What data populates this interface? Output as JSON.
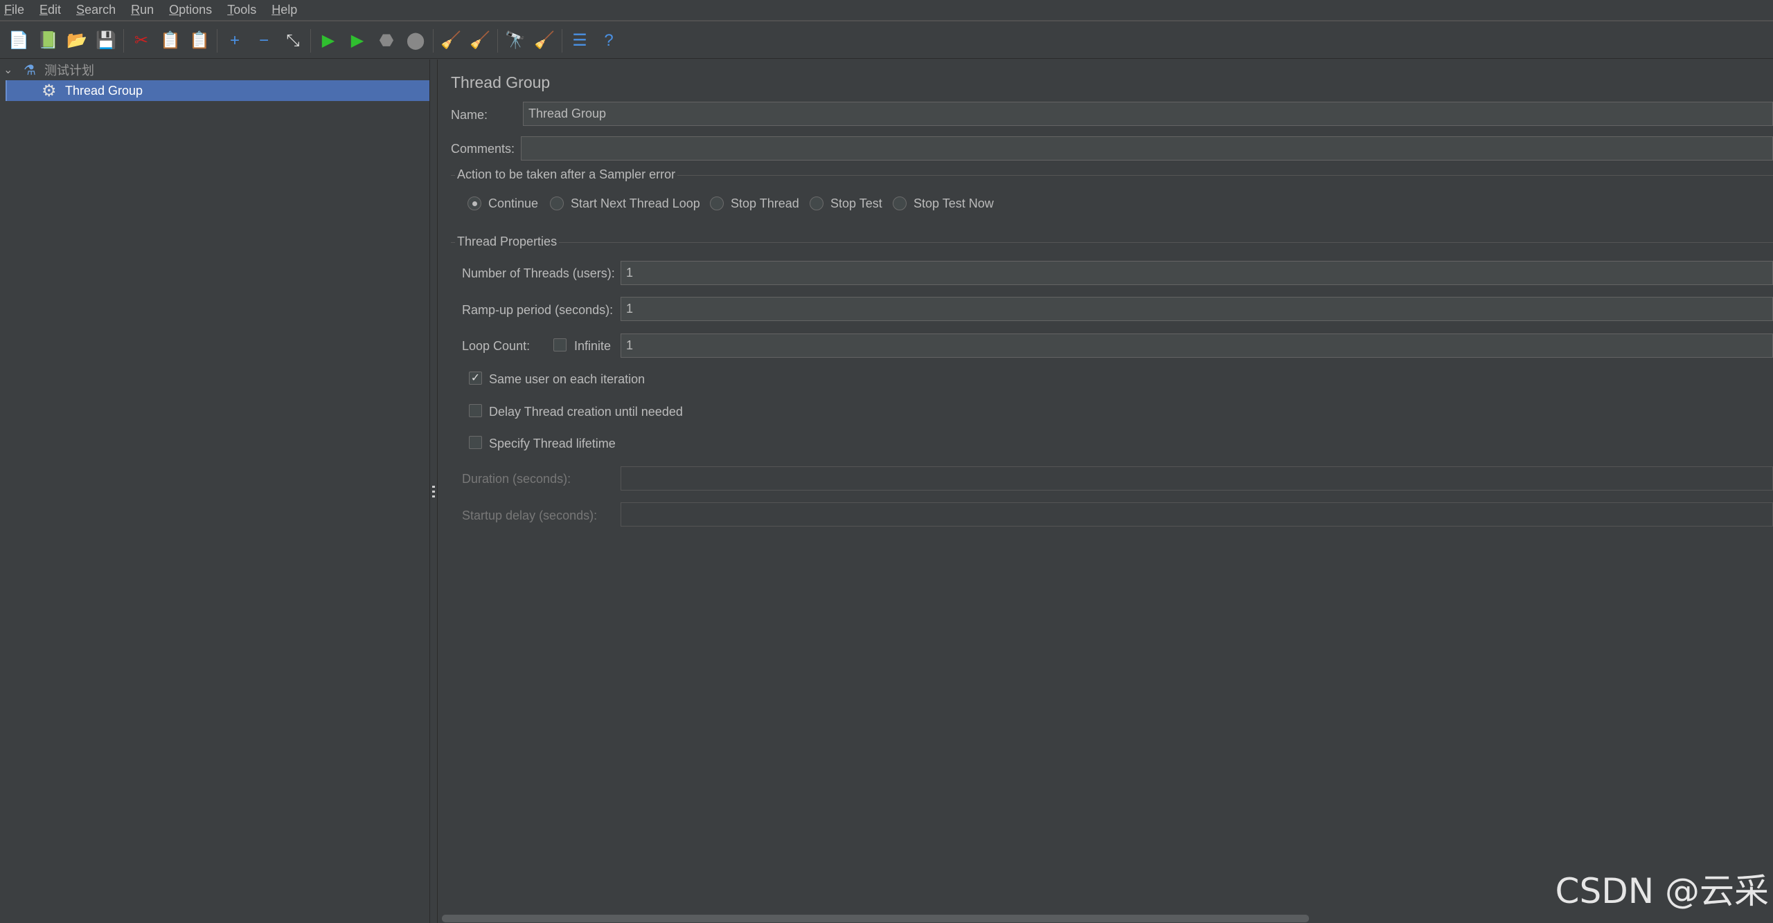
{
  "menu": [
    "File",
    "Edit",
    "Search",
    "Run",
    "Options",
    "Tools",
    "Help"
  ],
  "toolbar": [
    {
      "name": "new-icon",
      "glyph": "📄"
    },
    {
      "name": "templates-icon",
      "glyph": "📗"
    },
    {
      "name": "open-icon",
      "glyph": "📂"
    },
    {
      "name": "save-icon",
      "glyph": "💾"
    },
    {
      "sep": true
    },
    {
      "name": "cut-icon",
      "glyph": "✂"
    },
    {
      "name": "copy-icon",
      "glyph": "📋"
    },
    {
      "name": "paste-icon",
      "glyph": "📋"
    },
    {
      "sep": true
    },
    {
      "name": "expand-icon",
      "glyph": "+"
    },
    {
      "name": "collapse-icon",
      "glyph": "−"
    },
    {
      "name": "toggle-icon",
      "glyph": "⤡"
    },
    {
      "sep": true
    },
    {
      "name": "start-icon",
      "glyph": "▶"
    },
    {
      "name": "start-no-pause-icon",
      "glyph": "▶"
    },
    {
      "name": "stop-icon",
      "glyph": "⬣"
    },
    {
      "name": "shutdown-icon",
      "glyph": "⬤"
    },
    {
      "sep": true
    },
    {
      "name": "clear-icon",
      "glyph": "🧹"
    },
    {
      "name": "clear-all-icon",
      "glyph": "🧹"
    },
    {
      "sep": true
    },
    {
      "name": "search-icon",
      "glyph": "🔭"
    },
    {
      "name": "reset-search-icon",
      "glyph": "🧹"
    },
    {
      "sep": true
    },
    {
      "name": "function-helper-icon",
      "glyph": "☰"
    },
    {
      "name": "help-icon",
      "glyph": "?"
    }
  ],
  "tree": {
    "root": "测试计划",
    "child": "Thread Group"
  },
  "panel": {
    "title": "Thread Group",
    "name_label": "Name:",
    "name_value": "Thread Group",
    "comments_label": "Comments:",
    "comments_value": "",
    "action_section": "Action to be taken after a Sampler error",
    "actions": [
      {
        "label": "Continue",
        "selected": true
      },
      {
        "label": "Start Next Thread Loop",
        "selected": false
      },
      {
        "label": "Stop Thread",
        "selected": false
      },
      {
        "label": "Stop Test",
        "selected": false
      },
      {
        "label": "Stop Test Now",
        "selected": false
      }
    ],
    "props_section": "Thread Properties",
    "threads_label": "Number of Threads (users):",
    "threads_value": "1",
    "rampup_label": "Ramp-up period (seconds):",
    "rampup_value": "1",
    "loop_label": "Loop Count:",
    "infinite_label": "Infinite",
    "infinite_checked": false,
    "loop_value": "1",
    "same_user_label": "Same user on each iteration",
    "same_user_checked": true,
    "delay_label": "Delay Thread creation until needed",
    "delay_checked": false,
    "lifetime_label": "Specify Thread lifetime",
    "lifetime_checked": false,
    "duration_label": "Duration (seconds):",
    "duration_value": "",
    "startup_label": "Startup delay (seconds):",
    "startup_value": ""
  },
  "watermark": "CSDN @云采",
  "colors": {
    "background": "#3c3f41",
    "selection": "#4b6eaf",
    "field": "#45494a",
    "text": "#bbbbbb"
  }
}
